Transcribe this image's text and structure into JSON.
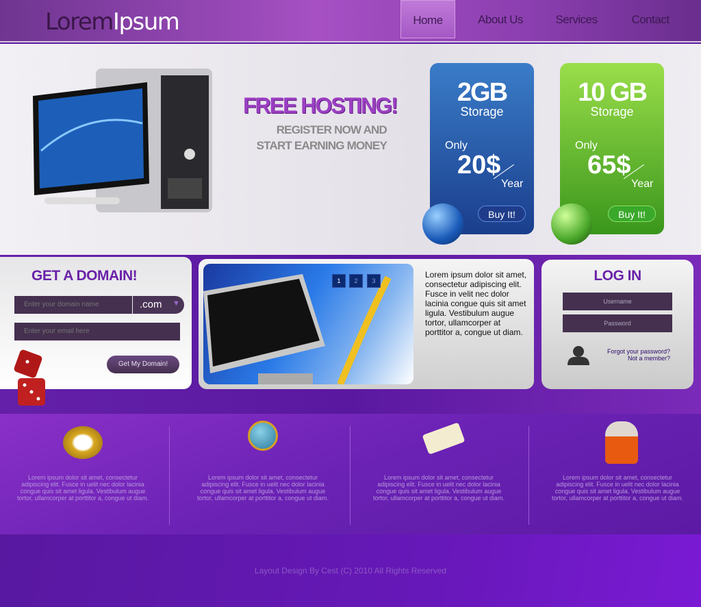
{
  "header": {
    "logo_part1": "Lorem",
    "logo_part2": "Ipsum",
    "nav": [
      {
        "label": "Home",
        "active": true
      },
      {
        "label": "About Us"
      },
      {
        "label": "Services"
      },
      {
        "label": "Contact"
      }
    ]
  },
  "hero": {
    "headline": "FREE HOSTING!",
    "sub1": "REGISTER NOW AND",
    "sub2": "START EARNING MONEY",
    "plans": [
      {
        "size": "2GB",
        "storage": "Storage",
        "only": "Only",
        "price": "20$",
        "period": "Year",
        "button": "Buy It!",
        "color": "#1e4e9c"
      },
      {
        "size": "10 GB",
        "storage": "Storage",
        "only": "Only",
        "price": "65$",
        "period": "Year",
        "button": "Buy It!",
        "color": "#4aa82a"
      }
    ]
  },
  "domain": {
    "title": "GET A DOMAIN!",
    "domain_placeholder": "Enter your domain name",
    "tld": ".com",
    "email_placeholder": "Enter your email here",
    "button": "Get My Domain!"
  },
  "slider": {
    "pages": [
      "1",
      "2",
      "3"
    ],
    "active_page": 1,
    "text": "Lorem ipsum dolor sit amet, consectetur adipiscing elit. Fusce in velit nec dolor lacinia congue quis sit amet ligula. Vestibulum augue tortor, ullamcorper at porttitor a, congue ut diam."
  },
  "login": {
    "title": "LOG IN",
    "username_placeholder": "Username",
    "password_placeholder": "Password",
    "forgot": "Forgot your password?",
    "not_member": "Not a member?"
  },
  "features": [
    {
      "icon": "compass-icon",
      "text": "Lorem ipsum dolor sit amet, consectetur adipiscing elit. Fusce in uelit nec dolor lacinia congue quis sit amet ligula. Vestibulum augue tortor, ullamcorper at porttitor a, congue ut diam."
    },
    {
      "icon": "globe-icon",
      "text": "Lorem ipsum dolor sit amet, consectetur adipiscing elit. Fusce in uelit nec dolor lacinia congue quis sit amet ligula. Vestibulum augue tortor, ullamcorper at porttitor a, congue ut diam."
    },
    {
      "icon": "scroll-icon",
      "text": "Lorem ipsum dolor sit amet, consectetur adipiscing elit. Fusce in uelit nec dolor lacinia congue quis sit amet ligula. Vestibulum augue tortor, ullamcorper at porttitor a, congue ut diam."
    },
    {
      "icon": "person-icon",
      "text": "Lorem ipsum dolor sit amet, consectetur adipiscing elit. Fusce in uelit nec dolor lacinia congue quis sit amet ligula. Vestibulum augue tortor, ullamcorper at porttitor a, congue ut diam."
    }
  ],
  "footer": {
    "copyright": "Layout Design By Cest (C) 2010 All Rights Reserved"
  }
}
